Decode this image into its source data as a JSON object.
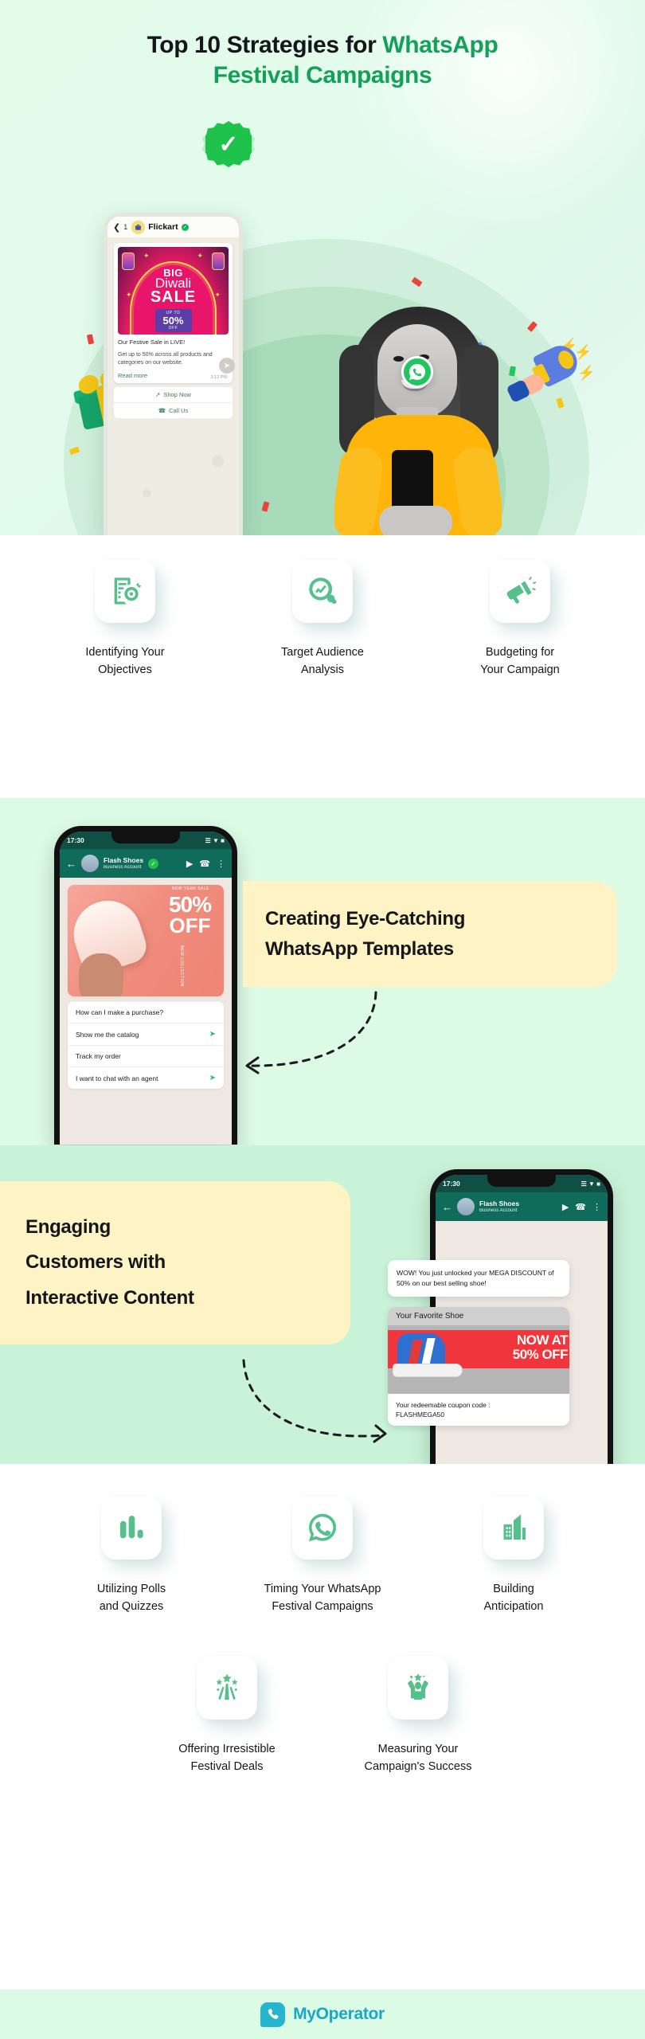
{
  "title": {
    "line1_black": "Top 10 Strategies for ",
    "line1_green": "WhatsApp",
    "line2_green": "Festival Campaigns"
  },
  "hero": {
    "phone": {
      "back_count": "1",
      "brand": "Flickart",
      "verified_icon": "verified-check-icon",
      "creative": {
        "big": "BIG",
        "diwali": "Diwali",
        "sale": "SALE",
        "upto": "UP TO",
        "percent": "50%",
        "off": "OFF"
      },
      "message_line1": "Our Festive Sale in LIVE!",
      "message_line2": "Get up to 50% across all products and categories on our website.",
      "read_more": "Read more",
      "time": "3:12 PM",
      "button_shop": "Shop Now",
      "button_call": "Call Us"
    },
    "badge_icon": "green-verified-badge-icon",
    "whatsapp_icon": "whatsapp-icon",
    "megaphone_icon": "megaphone-icon",
    "gift_icon": "gift-box-icon"
  },
  "strategy_row_1": [
    {
      "icon": "checklist-target-icon",
      "label_line1": "Identifying Your",
      "label_line2": "Objectives"
    },
    {
      "icon": "magnifier-analytics-icon",
      "label_line1": "Target Audience",
      "label_line2": "Analysis"
    },
    {
      "icon": "megaphone-icon",
      "label_line1": "Budgeting for",
      "label_line2": "Your Campaign"
    }
  ],
  "templates_section": {
    "heading_line1": "Creating Eye-Catching",
    "heading_line2": "WhatsApp Templates",
    "phone": {
      "status_time": "17:30",
      "status_icons": "signal-wifi-battery-icon",
      "contact_name": "Flash Shoes",
      "contact_sub": "Business Account",
      "verified_icon": "verified-check-icon",
      "header_icons": [
        "video-call-icon",
        "phone-call-icon",
        "more-options-icon"
      ],
      "promo_percent": "50%",
      "promo_off": "OFF",
      "promo_tag": "NEW YEAR SALE",
      "promo_collection": "NEW COLLECTION",
      "quick_replies": [
        "How can I make a purchase?",
        "Show me the catalog",
        "Track my order",
        "I want to chat with an agent"
      ]
    }
  },
  "engaging_section": {
    "heading_line1": "Engaging",
    "heading_line2": "Customers with",
    "heading_line3": "Interactive Content",
    "phone": {
      "status_time": "17:30",
      "contact_name": "Flash Shoes",
      "contact_sub": "Business Account",
      "bubble_text": "WOW! You just unlocked your MEGA DISCOUNT of 50% on our best selling shoe!",
      "card_title": "Your Favorite Shoe",
      "card_now": "NOW AT",
      "card_off": "50% OFF",
      "coupon_label": "Your redeemable coupon code :",
      "coupon_code": "FLASHMEGA50"
    }
  },
  "strategy_row_2": [
    {
      "icon": "bar-chart-poll-icon",
      "label_line1": "Utilizing Polls",
      "label_line2": "and Quizzes"
    },
    {
      "icon": "whatsapp-icon",
      "label_line1": "Timing Your WhatsApp",
      "label_line2": "Festival Campaigns"
    },
    {
      "icon": "building-growth-icon",
      "label_line1": "Building",
      "label_line2": "Anticipation"
    }
  ],
  "strategy_row_3": [
    {
      "icon": "fireworks-sparkle-icon",
      "label_line1": "Offering Irresistible",
      "label_line2": "Festival Deals"
    },
    {
      "icon": "person-celebrate-star-icon",
      "label_line1": "Measuring Your",
      "label_line2": "Campaign's Success"
    }
  ],
  "footer": {
    "logo_icon": "myoperator-phone-icon",
    "brand": "MyOperator"
  },
  "colors": {
    "brand_green": "#15a05a",
    "icon_green": "#55c08c",
    "mint_bg": "#dcfbe4",
    "mint_bg_2": "#c9f3d8",
    "yellow_panel": "#fdf3c4",
    "footer_teal": "#1aa7c6"
  }
}
